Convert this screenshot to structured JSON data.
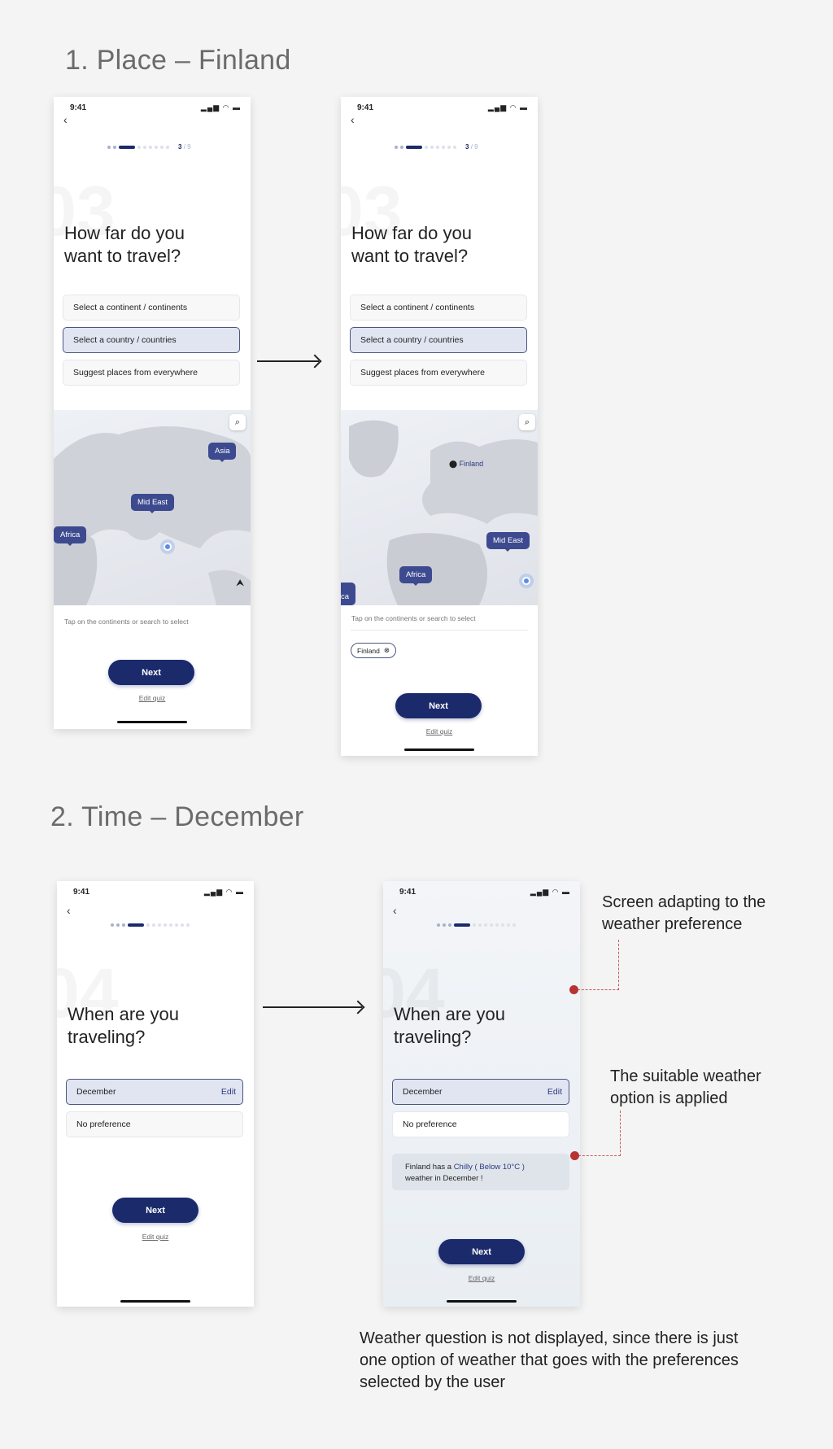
{
  "sections": [
    {
      "title": "1. Place – Finland"
    },
    {
      "title": "2. Time – December"
    }
  ],
  "status": {
    "time": "9:41",
    "icons": "signal wifi battery"
  },
  "place": {
    "step": "3",
    "total": "/ 9",
    "ghost_number": "03",
    "question_line1": "How far do you",
    "question_line2": "want to travel?",
    "options": [
      "Select a continent / continents",
      "Select a country / countries",
      "Suggest places from everywhere"
    ],
    "selected_option": 1,
    "map_tags_before": [
      "Asia",
      "Mid East",
      "Africa"
    ],
    "map_tags_after": [
      "Mid East",
      "Africa",
      "ca"
    ],
    "pin_label": "Finland",
    "hint": "Tap on the continents or search to select",
    "chip": "Finland",
    "next": "Next",
    "edit_quiz": "Edit quiz"
  },
  "time": {
    "ghost_number": "04",
    "question_line1": "When are you",
    "question_line2": "traveling?",
    "selected": "December",
    "edit": "Edit",
    "no_pref": "No preference",
    "info_prefix": "Finland has a ",
    "info_highlight": "Chilly ( Below 10°C )",
    "info_suffix": "weather in December !",
    "next": "Next",
    "edit_quiz": "Edit quiz"
  },
  "annotations": {
    "note1_l1": "Screen adapting to the",
    "note1_l2": "weather preference",
    "note2_l1": "The suitable weather",
    "note2_l2": "option is applied",
    "bottom_l1": "Weather question is not displayed, since there is just",
    "bottom_l2": "one option of weather that goes with the preferences",
    "bottom_l3": "selected by the user"
  },
  "colors": {
    "accent": "#1b2a6b",
    "tag": "#3d4a8f",
    "annotation": "#b83232"
  }
}
